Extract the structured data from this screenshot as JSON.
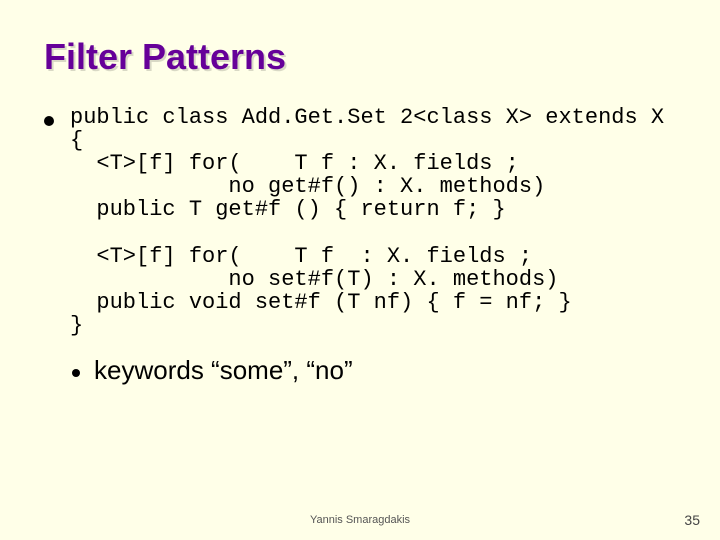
{
  "title": "Filter Patterns",
  "code": "public class Add.Get.Set 2<class X> extends X\n{\n  <T>[f] for(    T f : X. fields ;\n            no get#f() : X. methods)\n  public T get#f () { return f; }\n\n  <T>[f] for(    T f  : X. fields ;\n            no set#f(T) : X. methods)\n  public void set#f (T nf) { f = nf; }\n}",
  "keywords": "keywords “some”, “no”",
  "footer": "Yannis Smaragdakis",
  "page": "35"
}
